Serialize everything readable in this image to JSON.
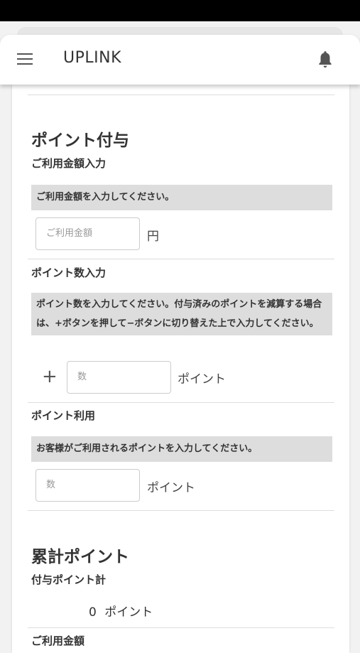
{
  "appbar": {
    "title": "UPLINK"
  },
  "point_grant": {
    "heading": "ポイント付与",
    "amount_label": "ご利用金額入力",
    "amount_note": "ご利用金額を入力してください。",
    "amount_placeholder": "ご利用金額",
    "amount_unit": "円",
    "points_label": "ポイント数入力",
    "points_note": "ポイント数を入力してください。付与済みのポイントを減算する場合は、+ボタンを押して−ボタンに切り替えた上で入力してください。",
    "points_sign": "+",
    "points_placeholder": "数",
    "points_unit": "ポイント",
    "use_label": "ポイント利用",
    "use_note": "お客様がご利用されるポイントを入力してください。",
    "use_placeholder": "数",
    "use_unit": "ポイント"
  },
  "totals": {
    "heading": "累計ポイント",
    "granted_label": "付与ポイント計",
    "granted_value": "0",
    "granted_unit": "ポイント",
    "amount_label_partial": "ご利用金額"
  }
}
